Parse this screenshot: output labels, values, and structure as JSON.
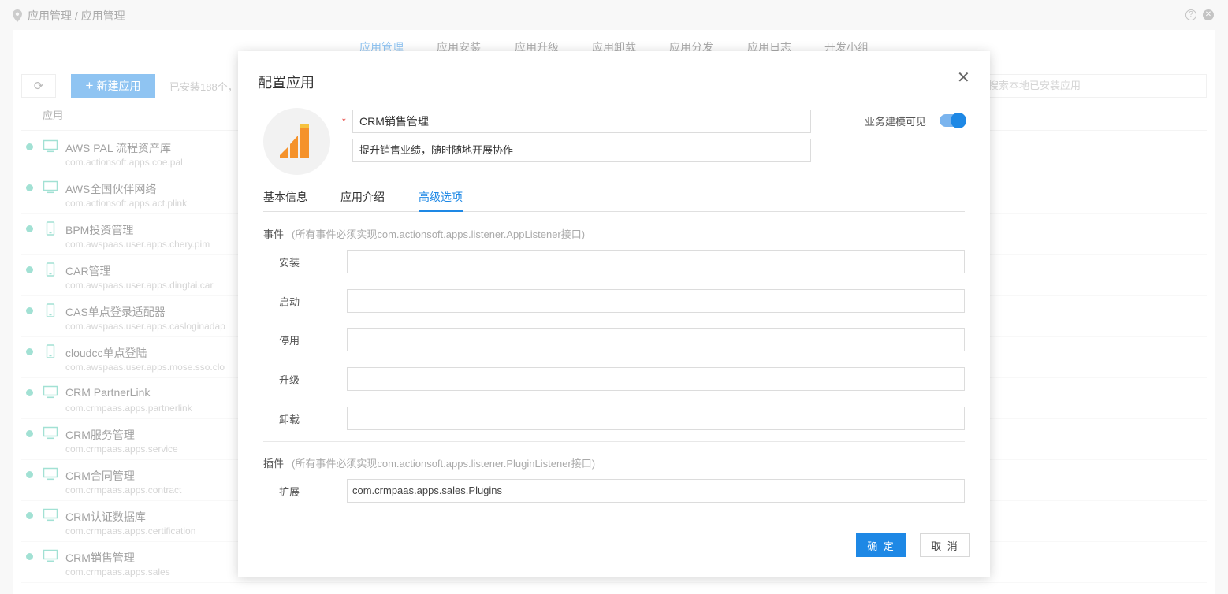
{
  "breadcrumb": "应用管理 / 应用管理",
  "nav_tabs": [
    "应用管理",
    "应用安装",
    "应用升级",
    "应用卸载",
    "应用分发",
    "应用日志",
    "开发小组"
  ],
  "active_nav_tab": "应用管理",
  "toolbar": {
    "new_app_label": "新建应用",
    "installed_count_text": "已安装188个，",
    "search_placeholder": "搜索本地已安装应用"
  },
  "table": {
    "column_app": "应用"
  },
  "apps": [
    {
      "name": "AWS PAL 流程资产库",
      "pkg": "com.actionsoft.apps.coe.pal",
      "device": "desktop"
    },
    {
      "name": "AWS全国伙伴网络",
      "pkg": "com.actionsoft.apps.act.plink",
      "device": "desktop"
    },
    {
      "name": "BPM投资管理",
      "pkg": "com.awspaas.user.apps.chery.pim",
      "device": "mobile"
    },
    {
      "name": "CAR管理",
      "pkg": "com.awspaas.user.apps.dingtai.car",
      "device": "mobile"
    },
    {
      "name": "CAS单点登录适配器",
      "pkg": "com.awspaas.user.apps.casloginadap",
      "device": "mobile"
    },
    {
      "name": "cloudcc单点登陆",
      "pkg": "com.awspaas.user.apps.mose.sso.clo",
      "device": "mobile"
    },
    {
      "name": "CRM PartnerLink",
      "pkg": "com.crmpaas.apps.partnerlink",
      "device": "desktop"
    },
    {
      "name": "CRM服务管理",
      "pkg": "com.crmpaas.apps.service",
      "device": "desktop"
    },
    {
      "name": "CRM合同管理",
      "pkg": "com.crmpaas.apps.contract",
      "device": "desktop"
    },
    {
      "name": "CRM认证数据库",
      "pkg": "com.crmpaas.apps.certification",
      "device": "desktop"
    },
    {
      "name": "CRM销售管理",
      "pkg": "com.crmpaas.apps.sales",
      "device": "desktop"
    }
  ],
  "dialog": {
    "title": "配置应用",
    "required_mark": "*",
    "app_name": "CRM销售管理",
    "app_desc": "提升销售业绩，随时随地开展协作",
    "visible_label": "业务建模可见",
    "visible_on": true,
    "tabs": [
      "基本信息",
      "应用介绍",
      "高级选项"
    ],
    "active_tab": "高级选项",
    "events_title": "事件",
    "events_hint": "(所有事件必须实现com.actionsoft.apps.listener.AppListener接口)",
    "event_fields": [
      {
        "label": "安装",
        "value": ""
      },
      {
        "label": "启动",
        "value": ""
      },
      {
        "label": "停用",
        "value": ""
      },
      {
        "label": "升级",
        "value": ""
      },
      {
        "label": "卸载",
        "value": ""
      }
    ],
    "plugins_title": "插件",
    "plugins_hint": "(所有事件必须实现com.actionsoft.apps.listener.PluginListener接口)",
    "plugin_field": {
      "label": "扩展",
      "value": "com.crmpaas.apps.sales.Plugins"
    },
    "ok_label": "确 定",
    "cancel_label": "取 消"
  },
  "colors": {
    "accent": "#1e88e5",
    "status_dot": "#45c3a8",
    "icon_orange": "#f5922b"
  }
}
